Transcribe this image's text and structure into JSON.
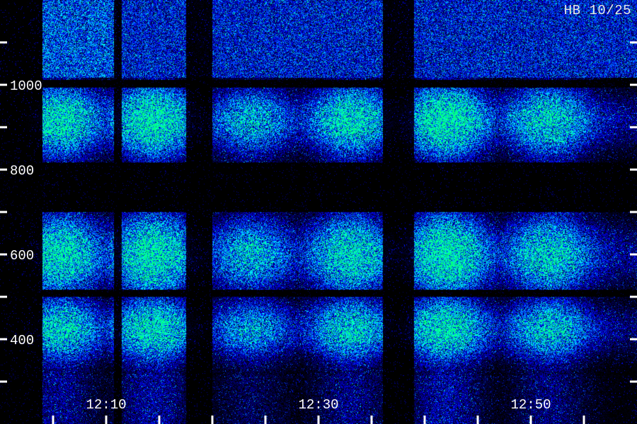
{
  "chart_data": {
    "type": "heatmap",
    "title": "",
    "station_label": "HB 10/25",
    "xlabel": "",
    "ylabel": "",
    "x_range": [
      "12:03",
      "12:59"
    ],
    "y_range": [
      240,
      1000
    ],
    "y_ticks_labeled": [
      {
        "label": "1000",
        "value": 1000
      },
      {
        "label": "800",
        "value": 800
      },
      {
        "label": "600",
        "value": 600
      },
      {
        "label": "400",
        "value": 400
      }
    ],
    "y_ticks_minor": [
      1100,
      900,
      700,
      500,
      300
    ],
    "x_ticks_labeled": [
      {
        "label": "12:10",
        "value": "12:10"
      },
      {
        "label": "12:30",
        "value": "12:30"
      },
      {
        "label": "12:50",
        "value": "12:50"
      }
    ],
    "x_ticks_minor": [
      "12:05",
      "12:15",
      "12:20",
      "12:25",
      "12:35",
      "12:40",
      "12:45",
      "12:55"
    ],
    "colormap": [
      "#000000",
      "#00006e",
      "#0000ff",
      "#0090ff",
      "#00ffff",
      "#00ff80"
    ],
    "grid": false
  }
}
